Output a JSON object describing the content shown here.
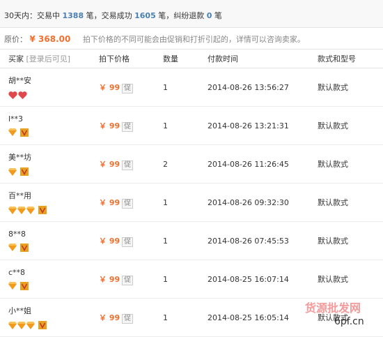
{
  "stats": {
    "prefix": "30天内：交易中",
    "in_trade": "1388",
    "unit1": "笔，交易成功",
    "success": "1605",
    "unit2": "笔，纠纷退款",
    "dispute": "0",
    "unit3": "笔"
  },
  "price": {
    "label": "原价：",
    "value": "¥ 368.00",
    "hint": "拍下价格的不同可能会由促销和打折引起的，详情可以咨询卖家。"
  },
  "columns": {
    "buyer": "买家",
    "buyer_sub": "[登录后可见]",
    "price": "拍下价格",
    "qty": "数量",
    "time": "付款时间",
    "style": "款式和型号"
  },
  "rows": [
    {
      "buyer": "胡**安",
      "badge": "hearts",
      "badge_count": 2,
      "verified": false,
      "price": "￥ 99",
      "promo": "促",
      "qty": "1",
      "time": "2014-08-26 13:56:27",
      "style": "默认款式"
    },
    {
      "buyer": "l**3",
      "badge": "gems",
      "badge_count": 1,
      "verified": true,
      "price": "￥ 99",
      "promo": "促",
      "qty": "1",
      "time": "2014-08-26 13:21:31",
      "style": "默认款式"
    },
    {
      "buyer": "美**坊",
      "badge": "gems",
      "badge_count": 1,
      "verified": true,
      "price": "￥ 99",
      "promo": "促",
      "qty": "2",
      "time": "2014-08-26 11:26:45",
      "style": "默认款式"
    },
    {
      "buyer": "百**用",
      "badge": "gems",
      "badge_count": 3,
      "verified": true,
      "price": "￥ 99",
      "promo": "促",
      "qty": "1",
      "time": "2014-08-26 09:32:30",
      "style": "默认款式"
    },
    {
      "buyer": "8**8",
      "badge": "gems",
      "badge_count": 1,
      "verified": true,
      "price": "￥ 99",
      "promo": "促",
      "qty": "1",
      "time": "2014-08-26 07:45:53",
      "style": "默认款式"
    },
    {
      "buyer": "c**8",
      "badge": "gems",
      "badge_count": 1,
      "verified": true,
      "price": "￥ 99",
      "promo": "促",
      "qty": "1",
      "time": "2014-08-25 16:07:14",
      "style": "默认款式"
    },
    {
      "buyer": "小**姐",
      "badge": "gems",
      "badge_count": 3,
      "verified": true,
      "price": "￥ 99",
      "promo": "促",
      "qty": "1",
      "time": "2014-08-25 16:05:14",
      "style": "默认款式"
    }
  ],
  "watermark": {
    "text1": "货源批发网",
    "text2": "6pf.cn"
  },
  "colors": {
    "price": "#f07030",
    "stat_num": "#4a7fb5",
    "gem": "#f29a1c",
    "heart": "#e0484e",
    "verified": "#e8a020"
  }
}
